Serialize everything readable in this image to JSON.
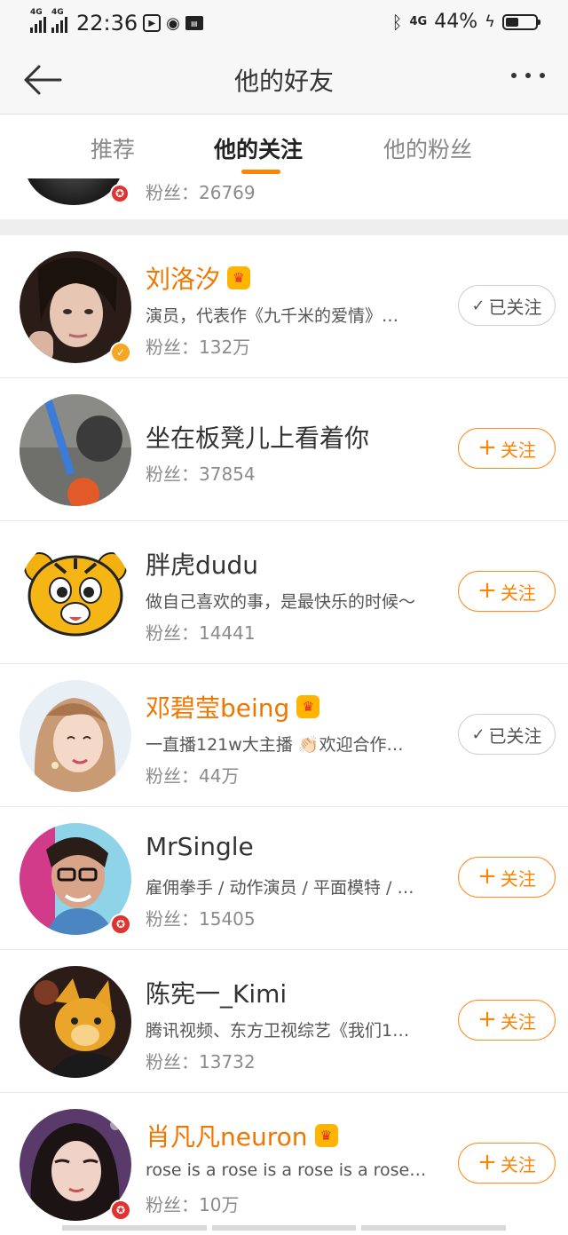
{
  "status_bar": {
    "network_1": "4G",
    "network_2": "4G",
    "time": "22:36",
    "battery_percent": "44%",
    "battery_level": 0.44,
    "network_right": "4G"
  },
  "navbar": {
    "title": "他的好友",
    "back_icon": "back-arrow-icon",
    "more_icon": "more-dots-icon"
  },
  "tabs": [
    {
      "label": "推荐",
      "active": false
    },
    {
      "label": "他的关注",
      "active": true
    },
    {
      "label": "他的粉丝",
      "active": false
    }
  ],
  "partial_row": {
    "fans": "粉丝：26769"
  },
  "users": [
    {
      "name": "刘洛汐",
      "vip": true,
      "desc": "演员，代表作《九千米的爱情》…",
      "fans": "粉丝：132万",
      "button": "已关注",
      "followed": true,
      "badge": "gold-v"
    },
    {
      "name": "坐在板凳儿上看着你",
      "vip": false,
      "desc": "",
      "fans": "粉丝：37854",
      "button": "关注",
      "followed": false,
      "badge": ""
    },
    {
      "name": "胖虎dudu",
      "vip": false,
      "desc": "做自己喜欢的事，是最快乐的时候～",
      "fans": "粉丝：14441",
      "button": "关注",
      "followed": false,
      "badge": ""
    },
    {
      "name": "邓碧莹being",
      "vip": true,
      "desc": "一直播121w大主播 👏🏻欢迎合作…",
      "fans": "粉丝：44万",
      "button": "已关注",
      "followed": true,
      "badge": ""
    },
    {
      "name": "MrSingle",
      "vip": false,
      "desc": "雇佣拳手 / 动作演员 / 平面模特 / …",
      "fans": "粉丝：15405",
      "button": "关注",
      "followed": false,
      "badge": "red"
    },
    {
      "name": "陈宪一_Kimi",
      "vip": false,
      "desc": "腾讯视频、东方卫视综艺《我们1…",
      "fans": "粉丝：13732",
      "button": "关注",
      "followed": false,
      "badge": ""
    },
    {
      "name": "肖凡凡neuron",
      "vip": true,
      "desc": "rose is a rose is a rose is a rose…",
      "fans": "粉丝：10万",
      "button": "关注",
      "followed": false,
      "badge": "red"
    }
  ],
  "colors": {
    "accent": "#ff8200",
    "vip_name": "#f07600"
  }
}
